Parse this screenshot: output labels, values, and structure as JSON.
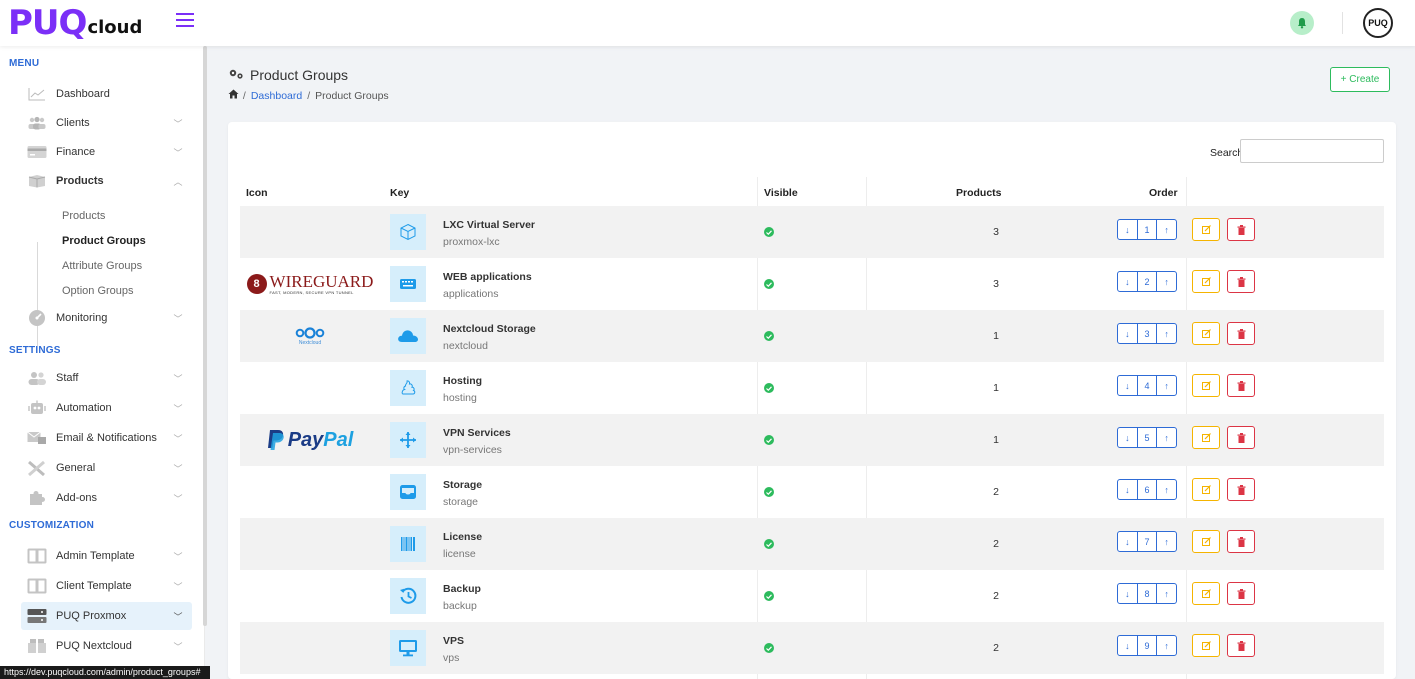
{
  "header": {
    "logo_main": "PUQ",
    "logo_suffix": "cloud",
    "avatar_text": "PUQ"
  },
  "sidebar": {
    "menu_title": "MENU",
    "settings_title": "SETTINGS",
    "customization_title": "CUSTOMIZATION",
    "items": {
      "dashboard": "Dashboard",
      "clients": "Clients",
      "finance": "Finance",
      "products": "Products",
      "monitoring": "Monitoring",
      "staff": "Staff",
      "automation": "Automation",
      "email": "Email & Notifications",
      "general": "General",
      "addons": "Add-ons",
      "admin_template": "Admin Template",
      "client_template": "Client Template",
      "puq_proxmox": "PUQ Proxmox",
      "puq_nextcloud": "PUQ Nextcloud"
    },
    "products_sub": [
      "Products",
      "Product Groups",
      "Attribute Groups",
      "Option Groups"
    ]
  },
  "statusbar": "https://dev.puqcloud.com/admin/product_groups#",
  "page": {
    "title": "Product Groups",
    "breadcrumb_link": "Dashboard",
    "breadcrumb_current": "Product Groups",
    "create_label": "+ Create"
  },
  "table": {
    "search_label": "Search",
    "search_value": "",
    "headers": [
      "Icon",
      "Key",
      "Visible",
      "Products",
      "Order"
    ],
    "rows": [
      {
        "name": "LXC Virtual Server",
        "key": "proxmox-lxc",
        "products": "3",
        "order": "1"
      },
      {
        "name": "WEB applications",
        "key": "applications",
        "products": "3",
        "order": "2"
      },
      {
        "name": "Nextcloud Storage",
        "key": "nextcloud",
        "products": "1",
        "order": "3"
      },
      {
        "name": "Hosting",
        "key": "hosting",
        "products": "1",
        "order": "4"
      },
      {
        "name": "VPN Services",
        "key": "vpn-services",
        "products": "1",
        "order": "5"
      },
      {
        "name": "Storage",
        "key": "storage",
        "products": "2",
        "order": "6"
      },
      {
        "name": "License",
        "key": "license",
        "products": "2",
        "order": "7"
      },
      {
        "name": "Backup",
        "key": "backup",
        "products": "2",
        "order": "8"
      },
      {
        "name": "VPS",
        "key": "vps",
        "products": "2",
        "order": "9"
      }
    ],
    "logos": {
      "wireguard_text": "WIREGUARD",
      "wireguard_tag": "FAST, MODERN, SECURE VPN TUNNEL",
      "nextcloud_tag": "Nextcloud",
      "paypal_1": "Pay",
      "paypal_2": "Pal"
    }
  },
  "colors": {
    "brand": "#7b2ff7",
    "link": "#2e6bd6",
    "success": "#2dbb5d",
    "warning": "#f5b400",
    "danger": "#dc3545",
    "icon_bg": "#d6eefb",
    "icon_fg": "#1e9be9"
  }
}
